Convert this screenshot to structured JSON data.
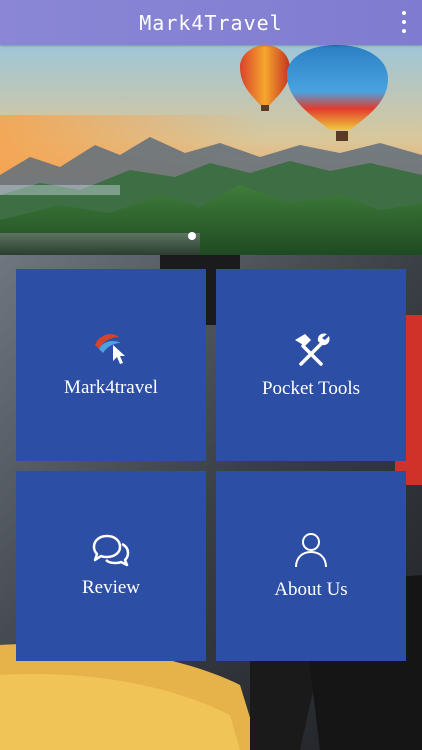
{
  "app_bar": {
    "title": "Mark4Travel",
    "menu_icon": "more-vertical-icon"
  },
  "banner": {
    "image": "hot-air-balloons-over-mountains",
    "active_slide": 1
  },
  "tiles": [
    {
      "label": "Mark4travel",
      "icon": "mark4travel-logo-icon"
    },
    {
      "label": "Pocket Tools",
      "icon": "hammer-wrench-icon"
    },
    {
      "label": "Review",
      "icon": "chat-bubbles-icon"
    },
    {
      "label": "About Us",
      "icon": "user-icon"
    }
  ],
  "colors": {
    "app_bar": "#8b87d6",
    "tile": "#2c4ea5",
    "text": "#ffffff"
  }
}
